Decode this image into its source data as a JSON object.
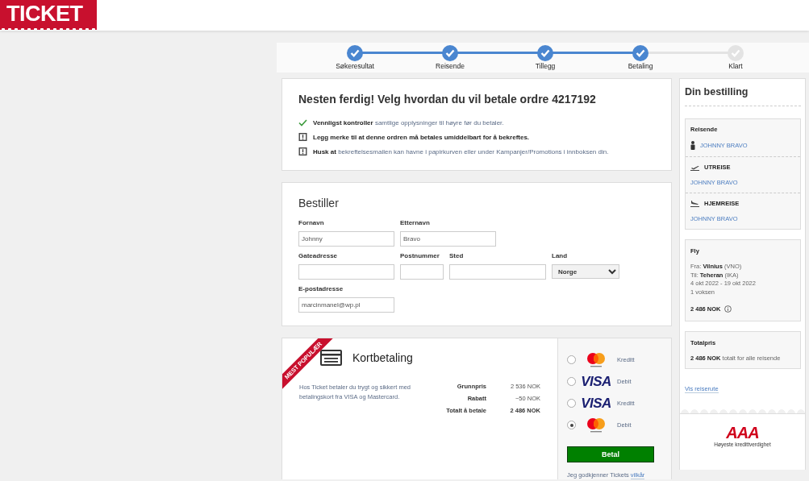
{
  "header": {
    "logo": "TICKET"
  },
  "steps": [
    {
      "label": "Søkeresultat",
      "done": true
    },
    {
      "label": "Reisende",
      "done": true
    },
    {
      "label": "Tillegg",
      "done": true
    },
    {
      "label": "Betaling",
      "done": true
    },
    {
      "label": "Klart",
      "done": false
    }
  ],
  "intro": {
    "title": "Nesten ferdig! Velg hvordan du vil betale ordre 4217192",
    "notes": [
      {
        "kind": "check",
        "strong": false,
        "text": "**Vennligst kontroller** samtlige opplysninger til høyre før du betaler."
      },
      {
        "kind": "warning",
        "strong": true,
        "text": "Legg merke til at denne ordren må betales umiddelbart for å bekreftes."
      },
      {
        "kind": "warning",
        "strong": false,
        "text": "**Husk at** bekreftelsesmailen kan havne i papirkurven eller under Kampanjer/Promotions i innboksen din."
      }
    ]
  },
  "booker": {
    "title": "Bestiller",
    "rows": [
      [
        {
          "label": "Fornavn",
          "value": "Johnny",
          "kind": "text"
        },
        {
          "label": "Etternavn",
          "value": "Bravo",
          "kind": "text"
        }
      ],
      [
        {
          "label": "Gateadresse",
          "kind": "text"
        },
        {
          "label": "Postnummer",
          "kind": "text"
        },
        {
          "label": "Sted",
          "kind": "text"
        },
        {
          "label": "Land",
          "value": "Norge",
          "kind": "select"
        }
      ],
      [
        {
          "label": "E-postadresse",
          "value": "marcinmanel@wp.pl",
          "kind": "text"
        }
      ]
    ]
  },
  "payment": {
    "ribbon": "MEST POPULÆR",
    "title": "Kortbetaling",
    "description": "Hos Ticket betaler du trygt og sikkert med betalingskort fra VISA og Mastercard.",
    "prices": [
      {
        "label": "Grunnpris",
        "value": "2 536 NOK",
        "total": false
      },
      {
        "label": "Rabatt",
        "value": "−50 NOK",
        "total": false
      },
      {
        "label": "Totalt å betale",
        "value": "2 486 NOK",
        "total": true
      }
    ],
    "options": [
      {
        "kind": "mastercard",
        "type": "Kreditt",
        "selected": false
      },
      {
        "kind": "visa",
        "logo": "VISA",
        "type": "Debit",
        "selected": false
      },
      {
        "kind": "visa",
        "logo": "VISA",
        "type": "Kreditt",
        "selected": false
      },
      {
        "kind": "mastercard",
        "type": "Debit",
        "selected": true
      }
    ],
    "button": "Betal",
    "terms": "Jeg godkjenner Tickets",
    "terms_link": "vilkår"
  },
  "summary": {
    "title": "Din bestilling",
    "travelers_heading": "Reisende",
    "traveler": "JOHNNY BRAVO",
    "legs": [
      {
        "kind": "outbound",
        "label": "UTREISE",
        "name": "JOHNNY BRAVO"
      },
      {
        "kind": "return",
        "label": "HJEMREISE",
        "name": "JOHNNY BRAVO"
      }
    ],
    "flight": {
      "heading": "Fly",
      "lines": [
        "Fra: **Vilnius** (VNO)",
        "Til: **Teheran** (IKA)",
        "4 okt 2022 - 19 okt 2022",
        "1 voksen"
      ],
      "price": "2 486 NOK"
    },
    "total": {
      "heading": "Totalpris",
      "price": "2 486 NOK",
      "note": "totalt for alle reisende"
    },
    "link": "Vis reiserute"
  },
  "badge": {
    "logo": "AAA",
    "caption": "Høyeste kredittverdighet"
  }
}
